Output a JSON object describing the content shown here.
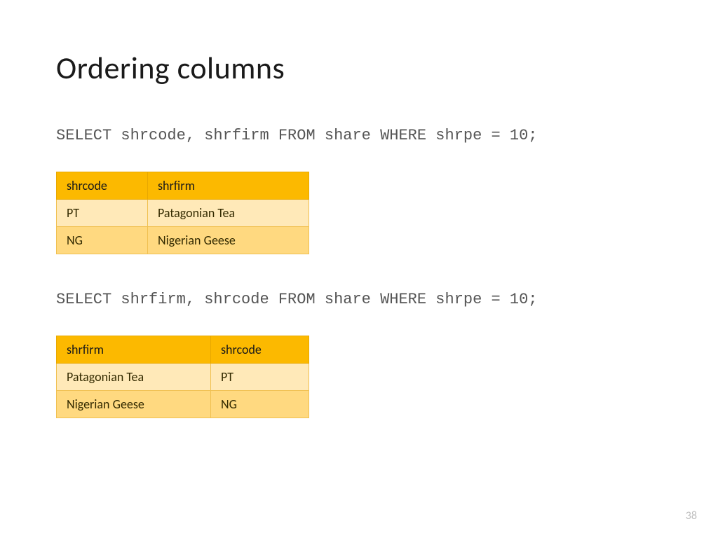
{
  "title": "Ordering columns",
  "sql1": "SELECT shrcode, shrfirm FROM share WHERE shrpe = 10;",
  "table1": {
    "headers": [
      "shrcode",
      "shrfirm"
    ],
    "rows": [
      [
        "PT",
        "Patagonian Tea"
      ],
      [
        "NG",
        "Nigerian Geese"
      ]
    ]
  },
  "sql2": "SELECT shrfirm, shrcode FROM share WHERE shrpe = 10;",
  "table2": {
    "headers": [
      "shrfirm",
      "shrcode"
    ],
    "rows": [
      [
        "Patagonian Tea",
        "PT"
      ],
      [
        "Nigerian Geese",
        "NG"
      ]
    ]
  },
  "page_number": "38"
}
